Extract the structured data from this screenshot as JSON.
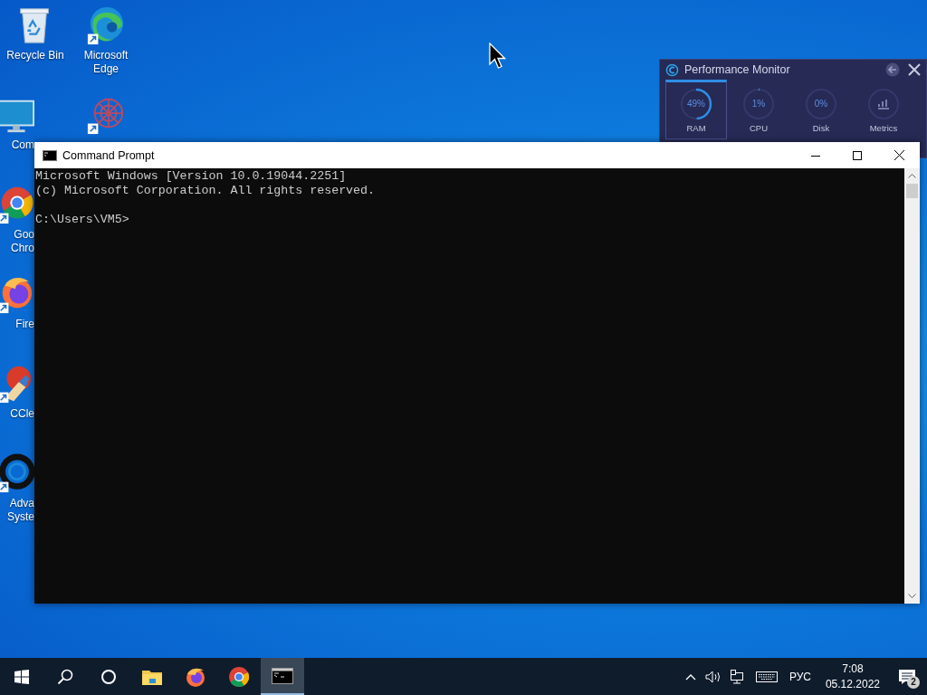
{
  "desktop_icons": [
    {
      "kind": "recycle",
      "label": [
        "Recycle Bin"
      ],
      "clipped": false
    },
    {
      "kind": "edge",
      "label": [
        "Microsoft",
        "Edge"
      ],
      "clipped": false
    },
    {
      "kind": "computer",
      "label": [
        "Com"
      ],
      "clipped": true
    },
    {
      "kind": "gear",
      "clipped": false
    },
    {
      "kind": "chrome",
      "label": [
        "Goo",
        "Chro"
      ],
      "clipped": true
    },
    {
      "kind": "firefox",
      "label": [
        "Fire"
      ],
      "clipped": true
    },
    {
      "kind": "ccleaner",
      "label": [
        "CCle"
      ],
      "clipped": true
    },
    {
      "kind": "asc",
      "label": [
        "Adva",
        "Syste"
      ],
      "clipped": true
    }
  ],
  "performance_monitor": {
    "title": "Performance Monitor",
    "tabs": [
      {
        "label": "RAM",
        "reading": "49%",
        "level": 0.49,
        "selected": true,
        "kind": "gauge"
      },
      {
        "label": "CPU",
        "reading": "1%",
        "level": 0.01,
        "selected": false,
        "kind": "gauge"
      },
      {
        "label": "Disk",
        "reading": "0%",
        "level": 0,
        "selected": false,
        "kind": "gauge"
      },
      {
        "label": "Metrics",
        "selected": false,
        "kind": "chart"
      }
    ]
  },
  "command_prompt": {
    "title": "Command Prompt",
    "lines": [
      "Microsoft Windows [Version 10.0.19044.2251]",
      "(c) Microsoft Corporation. All rights reserved."
    ],
    "prompt": "C:\\Users\\VM5>"
  },
  "taskbar": {
    "items": [
      {
        "kind": "start",
        "selected": false
      },
      {
        "kind": "search",
        "selected": false
      },
      {
        "kind": "cortana",
        "selected": false
      },
      {
        "kind": "explorer",
        "selected": false
      },
      {
        "kind": "firefox",
        "selected": false
      },
      {
        "kind": "chrome",
        "selected": false
      },
      {
        "kind": "cmd",
        "selected": true
      }
    ],
    "tray": {
      "language": "РУС",
      "time": "7:08",
      "date": "05.12.2022",
      "notifications": "2"
    }
  }
}
